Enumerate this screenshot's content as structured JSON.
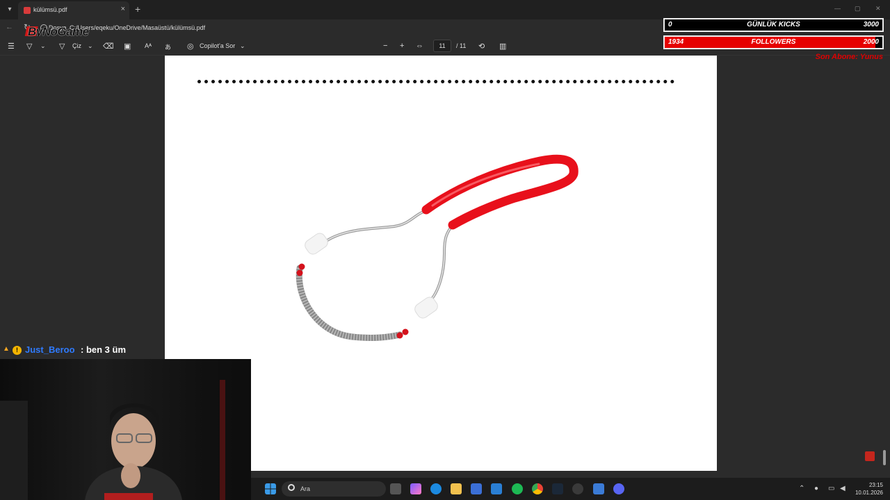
{
  "tab": {
    "title": "külümsü.pdf",
    "close": "×",
    "new": "+"
  },
  "address": {
    "label": "Dosya",
    "url": "C:/Users/eqeku/OneDrive/Masaüstü/külümsü.pdf"
  },
  "brand": {
    "name": "ByNoGame"
  },
  "toolbar": {
    "draw_label": "Çiz",
    "copilot_label": "Copilot'a Sor",
    "zoom_out": "−",
    "zoom_in": "+",
    "page_current": "11",
    "page_total": "/ 11"
  },
  "overlay": {
    "kicks": {
      "current": "0",
      "label": "GÜNLÜK KICKS",
      "goal": "3000",
      "progress": 0
    },
    "followers": {
      "current": "1934",
      "label": "FOLLOWERS",
      "goal": "2000",
      "progress": 0.967
    },
    "latest_sub_text": "Son Abone: Yunus"
  },
  "chat": {
    "username": "Just_Beroo",
    "message": ": ben 3 üm",
    "badge": "!"
  },
  "taskbar": {
    "search_placeholder": "Ara",
    "time": "23:15",
    "date": "10.01.2026"
  },
  "colors": {
    "accent_red": "#e60000",
    "chat_user": "#2f7bff",
    "product_red": "#e8101b"
  }
}
